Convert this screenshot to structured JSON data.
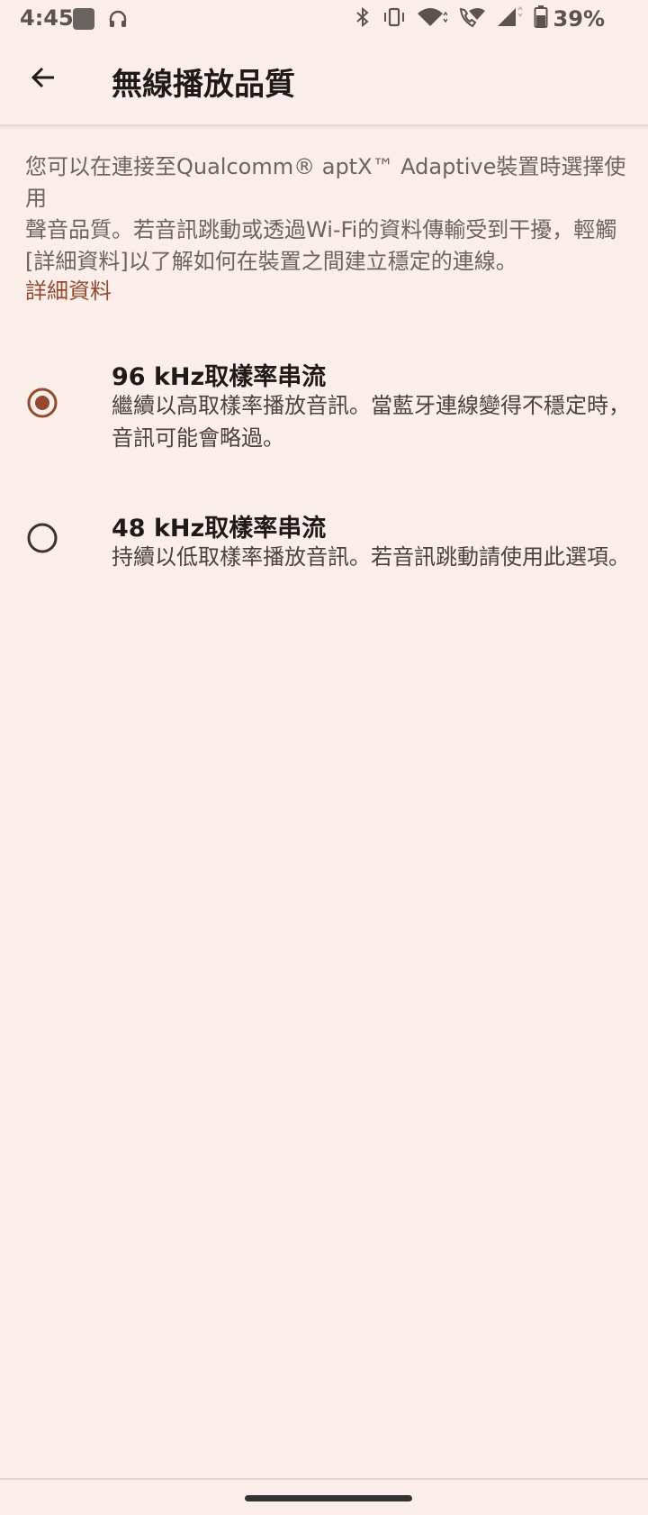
{
  "status_bar": {
    "time": "4:45",
    "battery": "39%",
    "icons": [
      "app-icon",
      "headphones-icon",
      "bluetooth-icon",
      "vibrate-icon",
      "wifi-icon",
      "wifi-call-icon",
      "signal-icon",
      "battery-icon"
    ]
  },
  "app_bar": {
    "title": "無線播放品質",
    "back_icon": "arrow-left-icon"
  },
  "description": {
    "line1": "您可以在連接至Qualcomm® aptX™ Adaptive裝置時選擇使用",
    "line2": "聲音品質。若音訊跳動或透過Wi-Fi的資料傳輸受到干擾，輕觸",
    "line3": "[詳細資料]以了解如何在裝置之間建立穩定的連線。"
  },
  "details_link": "詳細資料",
  "options": [
    {
      "title": "96 kHz取樣率串流",
      "line1": "繼續以高取樣率播放音訊。當藍牙連線變得不穩定時，",
      "line2": "音訊可能會略過。",
      "selected": true
    },
    {
      "title": "48 kHz取樣率串流",
      "line1": "持續以低取樣率播放音訊。若音訊跳動請使用此選項。",
      "line2": "",
      "selected": false
    }
  ],
  "colors": {
    "background": "#fbede9",
    "accent": "#934a2d",
    "text_primary": "#1f1a19",
    "text_secondary": "#6b6461"
  }
}
